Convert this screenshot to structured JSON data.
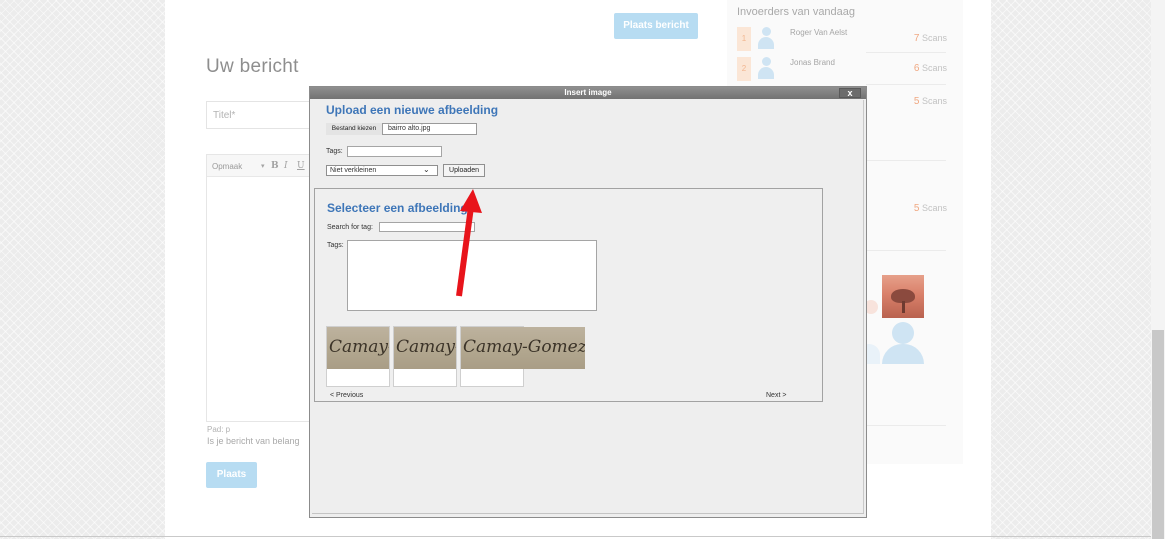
{
  "page": {
    "place_message_top": "Plaats bericht",
    "heading": "Uw bericht",
    "title_placeholder": "Titel*",
    "editor": {
      "format_label": "Opmaak",
      "bold": "B",
      "italic": "I",
      "underline": "U",
      "path": "Pad: p"
    },
    "important_label": "Is je bericht van belang",
    "place_button": "Plaats"
  },
  "sidebar": {
    "title": "Invoerders van vandaag",
    "users": [
      {
        "rank": "1",
        "name": "Roger Van Aelst",
        "count": "7",
        "unit": "Scans"
      },
      {
        "rank": "2",
        "name": "Jonas Brand",
        "count": "6",
        "unit": "Scans"
      },
      {
        "count": "5",
        "unit": "Scans"
      }
    ],
    "second_list": [
      {
        "count": "5",
        "unit": "Scans"
      }
    ]
  },
  "modal": {
    "title": "Insert image",
    "close_label": "x",
    "upload": {
      "heading": "Upload een nieuwe afbeelding",
      "choose_file_label": "Bestand kiezen",
      "file_name": "bairro alto.jpg",
      "tags_label": "Tags:",
      "tags_value": "",
      "resize_option": "Niet verkleinen",
      "upload_button": "Uploaden"
    },
    "select": {
      "heading": "Selecteer een afbeelding",
      "search_label": "Search for tag:",
      "search_value": "",
      "tags_label": "Tags:",
      "thumbnails": [
        {
          "text": "Camay-"
        },
        {
          "text": "Camay-"
        },
        {
          "text": "Camay-Gomez"
        }
      ],
      "previous": "< Previous",
      "next": "Next >"
    }
  },
  "colors": {
    "heading_blue": "#3e76b8",
    "arrow_red": "#e8141b",
    "button_blue": "#b7dcf2",
    "scans_orange": "#f0a882"
  },
  "icons": {
    "arrow": "red-pointer-arrow-icon",
    "dropdown": "chevron-down-icon",
    "avatar": "user-avatar-icon",
    "close": "close-icon"
  }
}
